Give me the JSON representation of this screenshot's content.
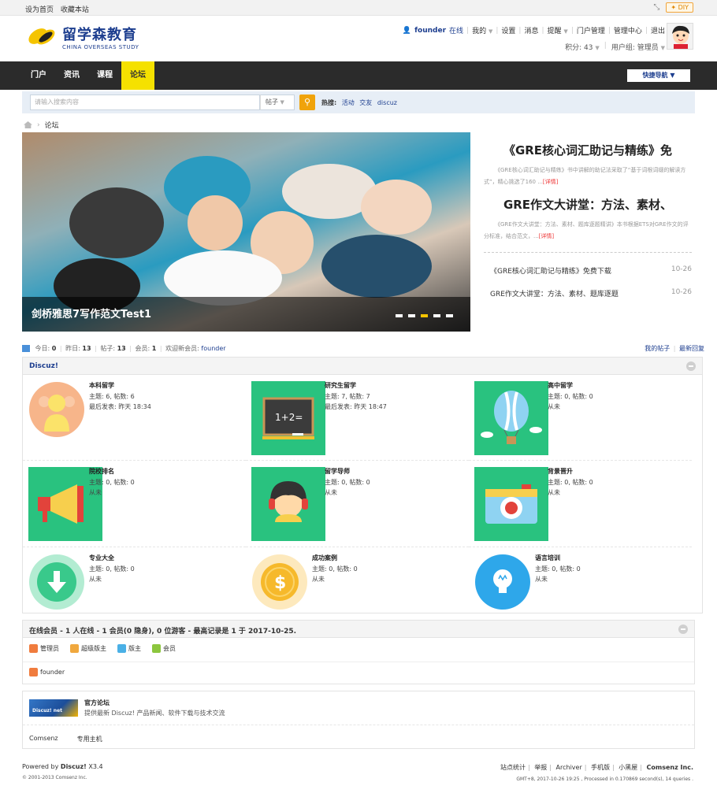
{
  "topbar": {
    "set_home": "设为首页",
    "bookmark": "收藏本站",
    "diy": "DIY"
  },
  "logo": {
    "cn": "留学森教育",
    "en": "CHINA OVERSEAS STUDY"
  },
  "user": {
    "name": "founder",
    "online": "在线",
    "my": "我的",
    "settings": "设置",
    "messages": "消息",
    "notify": "提醒",
    "portal_admin": "门户管理",
    "admin_center": "管理中心",
    "logout": "退出",
    "points": "积分: 43",
    "group": "用户组: 管理员"
  },
  "nav": {
    "items": [
      "门户",
      "资讯",
      "课程",
      "论坛"
    ],
    "active_index": 3,
    "quick": "快捷导航"
  },
  "search": {
    "placeholder": "请输入搜索内容",
    "type": "帖子",
    "hot_label": "热搜:",
    "hot": [
      "活动",
      "交友",
      "discuz"
    ]
  },
  "breadcrumb": {
    "current": "论坛"
  },
  "slider": {
    "caption": "剑桥雅思7写作范文Test1",
    "dots": 5,
    "active_dot": 2
  },
  "sidenews": {
    "h1": "《GRE核心词汇助记与精练》免",
    "d1": "《GRE核心词汇助记与精练》书中讲解的助记法采取了“基于词根词缀的解读方式”，精心挑选了160 ...",
    "h2": "GRE作文大讲堂：方法、素材、",
    "d2": "《GRE作文大讲堂：方法、素材、题库逐题精讲》本书根据ETS对GRE作文的评分标准，结合范文，...",
    "more": "[详情]",
    "items": [
      {
        "title": "《GRE核心词汇助记与精练》免费下载",
        "date": "10-26"
      },
      {
        "title": "GRE作文大讲堂：方法、素材、题库逐题",
        "date": "10-26"
      }
    ]
  },
  "stats": {
    "today_label": "今日:",
    "today": "0",
    "yesterday_label": "昨日:",
    "yesterday": "13",
    "posts_label": "帖子:",
    "posts": "13",
    "members_label": "会员:",
    "members": "1",
    "welcome": "欢迎新会员:",
    "new_member": "founder",
    "my_posts": "我的帖子",
    "latest": "最新回复"
  },
  "forumbox": {
    "title": "Discuz!",
    "forums": [
      {
        "name": "本科留学",
        "stat": "主题: 6, 帖数: 6",
        "last": "最后发表: 昨天 18:34",
        "icon": "student-icon"
      },
      {
        "name": "研究生留学",
        "stat": "主题: 7, 帖数: 7",
        "last": "最后发表: 昨天 18:47",
        "icon": "blackboard-icon"
      },
      {
        "name": "高中留学",
        "stat": "主题: 0, 帖数: 0",
        "last": "从未",
        "icon": "balloon-icon"
      },
      {
        "name": "院校排名",
        "stat": "主题: 0, 帖数: 0",
        "last": "从未",
        "icon": "megaphone-icon"
      },
      {
        "name": "留学导师",
        "stat": "主题: 0, 帖数: 0",
        "last": "从未",
        "icon": "headset-icon"
      },
      {
        "name": "背景晋升",
        "stat": "主题: 0, 帖数: 0",
        "last": "从未",
        "icon": "camera-icon"
      },
      {
        "name": "专业大全",
        "stat": "主题: 0, 帖数: 0",
        "last": "从未",
        "icon": "download-icon"
      },
      {
        "name": "成功案例",
        "stat": "主题: 0, 帖数: 0",
        "last": "从未",
        "icon": "coin-icon"
      },
      {
        "name": "语言培训",
        "stat": "主题: 0, 帖数: 0",
        "last": "从未",
        "icon": "bulb-icon"
      }
    ]
  },
  "online": {
    "title": "在线会员 - 1 人在线 - 1 会员(0 隐身), 0 位游客 - 最高记录是 1 于 2017-10-25.",
    "legend": [
      "管理员",
      "超级版主",
      "版主",
      "会员"
    ],
    "users": [
      "founder"
    ]
  },
  "links": {
    "logo": "Discuz! net",
    "title": "官方论坛",
    "desc": "提供最新 Discuz! 产品新闻、软件下载与技术交流",
    "text": [
      "Comsenz",
      "专用主机"
    ]
  },
  "footer": {
    "powered": "Powered by",
    "brand": "Discuz!",
    "version": "X3.4",
    "copyright": "© 2001-2013 Comsenz Inc.",
    "links": [
      "站点统计",
      "举报",
      "Archiver",
      "手机版",
      "小黑屋"
    ],
    "company": "Comsenz Inc.",
    "perf": "GMT+8, 2017-10-26 19:25 , Processed in 0.170869 second(s), 14 queries ."
  },
  "colors": {
    "accent": "#f5e100",
    "nav_bg": "#2b2b2b",
    "link": "#1d3e8f"
  }
}
